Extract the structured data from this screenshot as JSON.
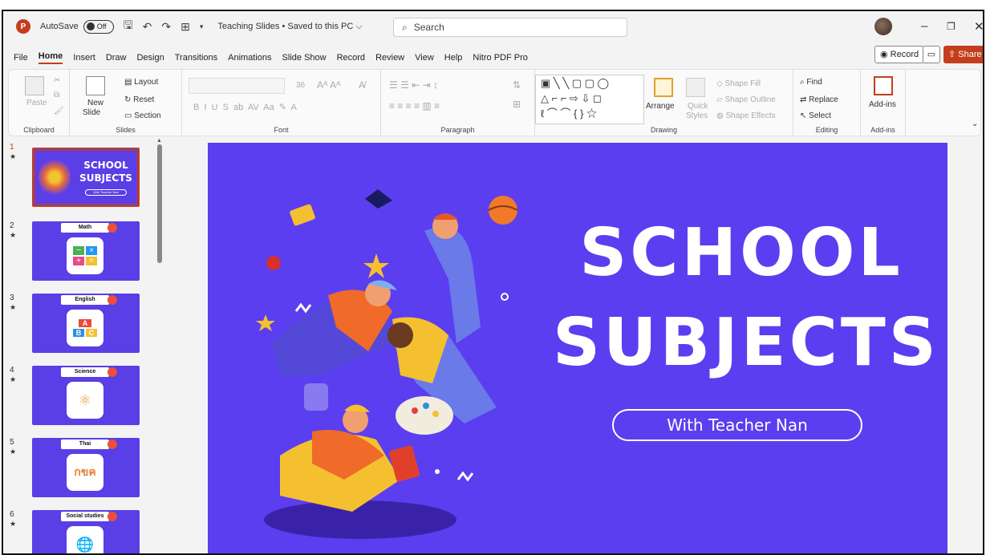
{
  "window": {
    "autosave_label": "AutoSave",
    "autosave_state": "Off",
    "doc_title": "Teaching Slides • Saved to this PC ⌵",
    "search_placeholder": "Search"
  },
  "menu": [
    "File",
    "Home",
    "Insert",
    "Draw",
    "Design",
    "Transitions",
    "Animations",
    "Slide Show",
    "Record",
    "Review",
    "View",
    "Help",
    "Nitro PDF Pro"
  ],
  "toolbar_right": {
    "record": "Record",
    "share": "Share"
  },
  "ribbon": {
    "clipboard": {
      "paste": "Paste",
      "label": "Clipboard"
    },
    "slides": {
      "new_slide": "New",
      "new_slide2": "Slide",
      "layout": "Layout",
      "reset": "Reset",
      "section": "Section",
      "label": "Slides"
    },
    "font": {
      "size": "36",
      "label": "Font"
    },
    "paragraph": {
      "label": "Paragraph"
    },
    "drawing": {
      "arrange": "Arrange",
      "quick_styles": "Quick",
      "quick_styles2": "Styles",
      "shape_fill": "Shape Fill",
      "shape_outline": "Shape Outline",
      "shape_effects": "Shape Effects",
      "label": "Drawing"
    },
    "editing": {
      "find": "Find",
      "replace": "Replace",
      "select": "Select",
      "label": "Editing"
    },
    "addins": {
      "addins": "Add-ins",
      "label": "Add-ins"
    }
  },
  "thumbnails": [
    {
      "num": "1",
      "title": "SCHOOL SUBJECTS",
      "subtitle": "With Teacher Nan",
      "selected": true
    },
    {
      "num": "2",
      "title": "Math",
      "icon": "math-icon"
    },
    {
      "num": "3",
      "title": "English",
      "icon": "abc-blocks-icon"
    },
    {
      "num": "4",
      "title": "Science",
      "icon": "atom-icon"
    },
    {
      "num": "5",
      "title": "Thai",
      "icon": "thai-letters-icon"
    },
    {
      "num": "6",
      "title": "Social studies",
      "icon": "globe-icon"
    }
  ],
  "slide": {
    "title_line1": "SCHOOL",
    "title_line2": "SUBJECTS",
    "subtitle": "With Teacher Nan"
  },
  "colors": {
    "slide_bg": "#5b3ef0",
    "accent": "#c43e1c"
  }
}
